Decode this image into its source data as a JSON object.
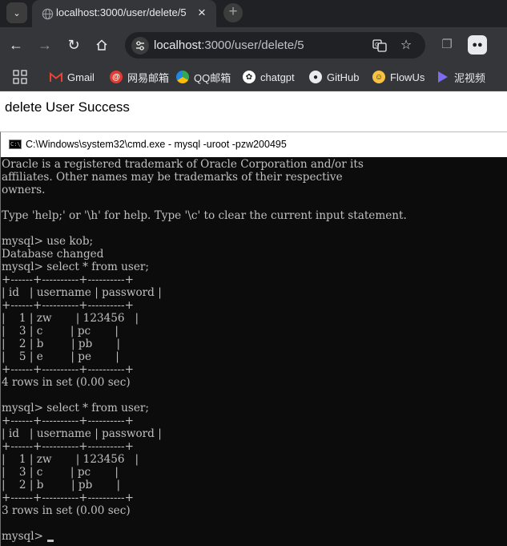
{
  "browser": {
    "tab": {
      "title": "localhost:3000/user/delete/5"
    },
    "address": {
      "host": "localhost",
      "path": ":3000/user/delete/5"
    },
    "bookmarks": [
      {
        "label": "Gmail",
        "icon": "gmail-icon",
        "color": "#ea4335"
      },
      {
        "label": "网易邮箱",
        "icon": "netease-mail-icon",
        "color": "#e03c31"
      },
      {
        "label": "QQ邮箱",
        "icon": "qq-mail-icon",
        "color": "#1e88e5"
      },
      {
        "label": "chatgpt",
        "icon": "chatgpt-icon",
        "color": "#ffffff"
      },
      {
        "label": "GitHub",
        "icon": "github-icon",
        "color": "#ffffff"
      },
      {
        "label": "FlowUs",
        "icon": "flowus-icon",
        "color": "#f6c343"
      },
      {
        "label": "泥视频",
        "icon": "video-icon",
        "color": "#7c6cf0"
      }
    ]
  },
  "page": {
    "message": "delete User Success"
  },
  "cmd": {
    "title": "C:\\Windows\\system32\\cmd.exe - mysql  -uroot -pzw200495",
    "lines": [
      "Oracle is a registered trademark of Oracle Corporation and/or its",
      "affiliates. Other names may be trademarks of their respective",
      "owners.",
      "",
      "Type 'help;' or '\\h' for help. Type '\\c' to clear the current input statement.",
      "",
      "mysql> use kob;",
      "Database changed",
      "mysql> select * from user;",
      "+------+----------+----------+",
      "| id   | username | password |",
      "+------+----------+----------+",
      "|    1 | zw       | 123456   |",
      "|    3 | c        | pc       |",
      "|    2 | b        | pb       |",
      "|    5 | e        | pe       |",
      "+------+----------+----------+",
      "4 rows in set (0.00 sec)",
      "",
      "mysql> select * from user;",
      "+------+----------+----------+",
      "| id   | username | password |",
      "+------+----------+----------+",
      "|    1 | zw       | 123456   |",
      "|    3 | c        | pc       |",
      "|    2 | b        | pb       |",
      "+------+----------+----------+",
      "3 rows in set (0.00 sec)",
      "",
      "mysql> "
    ]
  }
}
